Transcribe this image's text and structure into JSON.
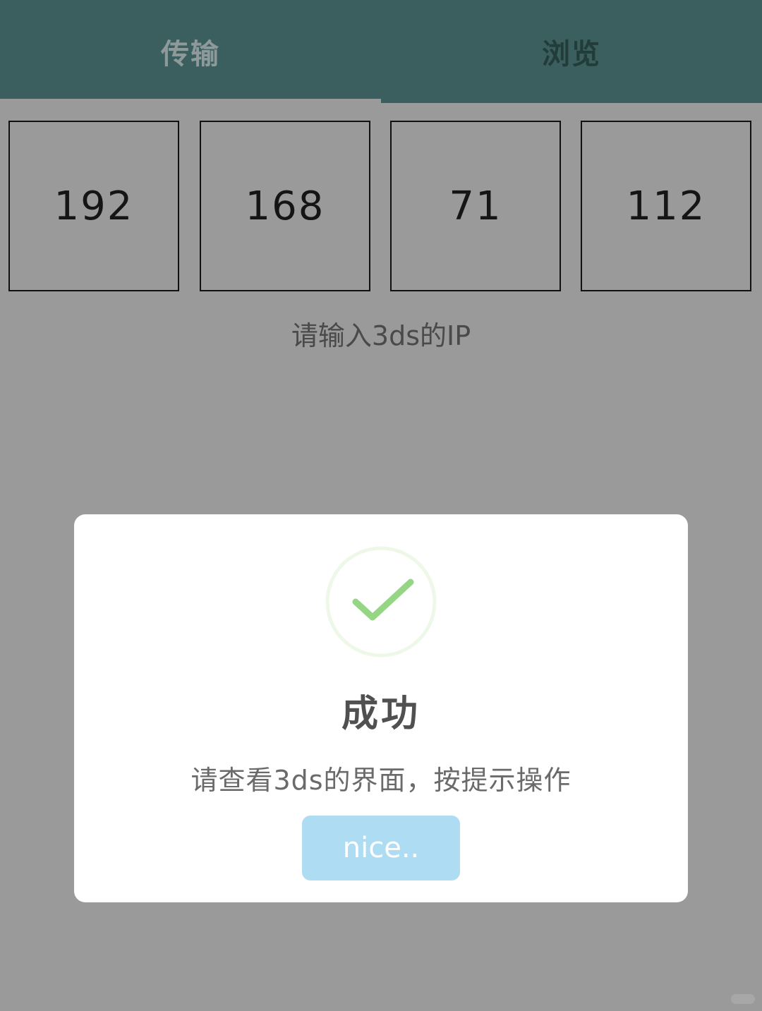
{
  "tabs": {
    "transfer_label": "传输",
    "browse_label": "浏览",
    "active": "transfer"
  },
  "ip": {
    "octet1": "192",
    "octet2": "168",
    "octet3": "71",
    "octet4": "112",
    "hint": "请输入3ds的IP"
  },
  "dialog": {
    "icon": "success-check-icon",
    "title": "成功",
    "message": "请查看3ds的界面，按提示操作",
    "button_label": "nice.."
  },
  "colors": {
    "tab_bar": "#3b5f5f",
    "overlay": "#9a9a9a",
    "check_green": "#95d685",
    "button_blue": "#aedcf2"
  }
}
